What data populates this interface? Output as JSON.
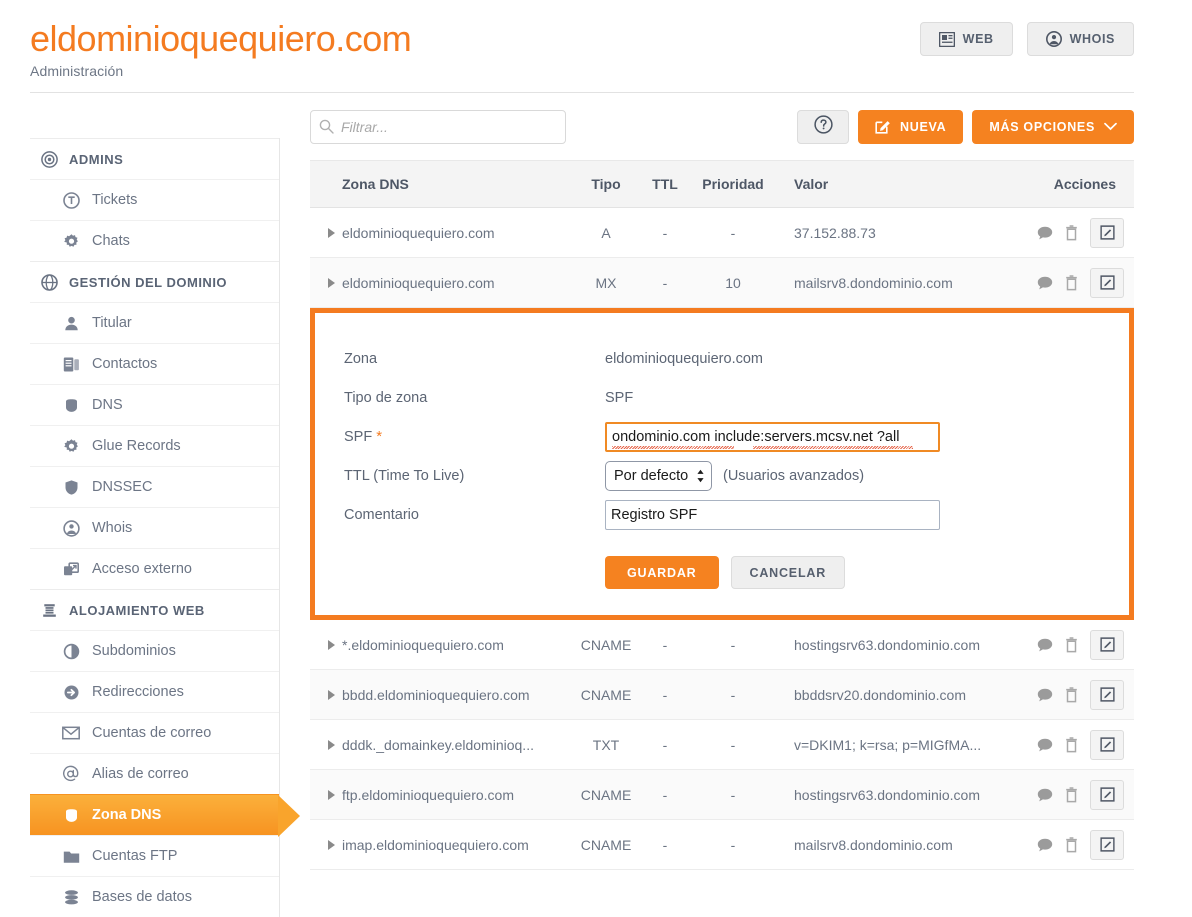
{
  "header": {
    "domain": "eldominioquequiero.com",
    "subtitle": "Administración",
    "buttons": [
      {
        "label": "WEB",
        "icon": "newspaper-icon"
      },
      {
        "label": "WHOIS",
        "icon": "user-circle-icon"
      }
    ]
  },
  "sidebar": {
    "groups": [
      {
        "title": "ADMINS",
        "icon": "target-icon",
        "items": [
          {
            "label": "Tickets",
            "icon": "ticket-icon",
            "active": false
          },
          {
            "label": "Chats",
            "icon": "gear-icon",
            "active": false
          }
        ]
      },
      {
        "title": "GESTIÓN DEL DOMINIO",
        "icon": "globe-icon",
        "items": [
          {
            "label": "Titular",
            "icon": "person-icon",
            "active": false
          },
          {
            "label": "Contactos",
            "icon": "contacts-icon",
            "active": false
          },
          {
            "label": "DNS",
            "icon": "badge-icon",
            "active": false
          },
          {
            "label": "Glue Records",
            "icon": "gear-icon",
            "active": false
          },
          {
            "label": "DNSSEC",
            "icon": "shield-icon",
            "active": false
          },
          {
            "label": "Whois",
            "icon": "user-circle-icon",
            "active": false
          },
          {
            "label": "Acceso externo",
            "icon": "external-window-icon",
            "active": false
          }
        ]
      },
      {
        "title": "ALOJAMIENTO WEB",
        "icon": "server-icon",
        "items": [
          {
            "label": "Subdominios",
            "icon": "half-circle-icon",
            "active": false
          },
          {
            "label": "Redirecciones",
            "icon": "arrow-circle-icon",
            "active": false
          },
          {
            "label": "Cuentas de correo",
            "icon": "envelope-icon",
            "active": false
          },
          {
            "label": "Alias de correo",
            "icon": "at-icon",
            "active": false
          },
          {
            "label": "Zona DNS",
            "icon": "badge-icon",
            "active": true
          },
          {
            "label": "Cuentas FTP",
            "icon": "folder-icon",
            "active": false
          },
          {
            "label": "Bases de datos",
            "icon": "database-icon",
            "active": false
          }
        ]
      }
    ]
  },
  "toolbar": {
    "filter_placeholder": "Filtrar...",
    "filter_value": "",
    "filter_icon": "search-icon",
    "help_icon": "question-circle-icon",
    "new_label": "NUEVA",
    "new_icon": "edit-square-icon",
    "more_label": "MÁS OPCIONES",
    "more_icon": "chevron-down-icon"
  },
  "table": {
    "headers": {
      "zone": "Zona DNS",
      "type": "Tipo",
      "ttl": "TTL",
      "priority": "Prioridad",
      "value": "Valor",
      "actions": "Acciones"
    },
    "rows_top": [
      {
        "zone": "eldominioquequiero.com",
        "type": "A",
        "ttl": "-",
        "priority": "-",
        "value": "37.152.88.73"
      },
      {
        "zone": "eldominioquequiero.com",
        "type": "MX",
        "ttl": "-",
        "priority": "10",
        "value": "mailsrv8.dondominio.com"
      }
    ],
    "rows_bottom": [
      {
        "zone": "*.eldominioquequiero.com",
        "type": "CNAME",
        "ttl": "-",
        "priority": "-",
        "value": "hostingsrv63.dondominio.com"
      },
      {
        "zone": "bbdd.eldominioquequiero.com",
        "type": "CNAME",
        "ttl": "-",
        "priority": "-",
        "value": "bbddsrv20.dondominio.com"
      },
      {
        "zone": "dddk._domainkey.eldominioq...",
        "type": "TXT",
        "ttl": "-",
        "priority": "-",
        "value": "v=DKIM1; k=rsa; p=MIGfMA..."
      },
      {
        "zone": "ftp.eldominioquequiero.com",
        "type": "CNAME",
        "ttl": "-",
        "priority": "-",
        "value": "hostingsrv63.dondominio.com"
      },
      {
        "zone": "imap.eldominioquequiero.com",
        "type": "CNAME",
        "ttl": "-",
        "priority": "-",
        "value": "mailsrv8.dondominio.com"
      }
    ],
    "row_icons": {
      "expand": "caret-right-icon",
      "comment": "speech-bubble-icon",
      "delete": "trash-icon",
      "edit": "edit-square-icon"
    }
  },
  "edit_panel": {
    "zone_label": "Zona",
    "zone_value": "eldominioquequiero.com",
    "zone_type_label": "Tipo de zona",
    "zone_type_value": "SPF",
    "spf_label": "SPF",
    "spf_required_marker": "*",
    "spf_value": "ondominio.com include:servers.mcsv.net ?all",
    "ttl_label": "TTL (Time To Live)",
    "ttl_value": "Por defecto",
    "ttl_note": "(Usuarios avanzados)",
    "comment_label": "Comentario",
    "comment_value": "Registro SPF",
    "save_label": "GUARDAR",
    "cancel_label": "CANCELAR"
  },
  "colors": {
    "brand_orange": "#f47b20",
    "button_orange": "#f58220",
    "active_nav_orange": "#f9a42c",
    "text_slate": "#5a6475"
  }
}
